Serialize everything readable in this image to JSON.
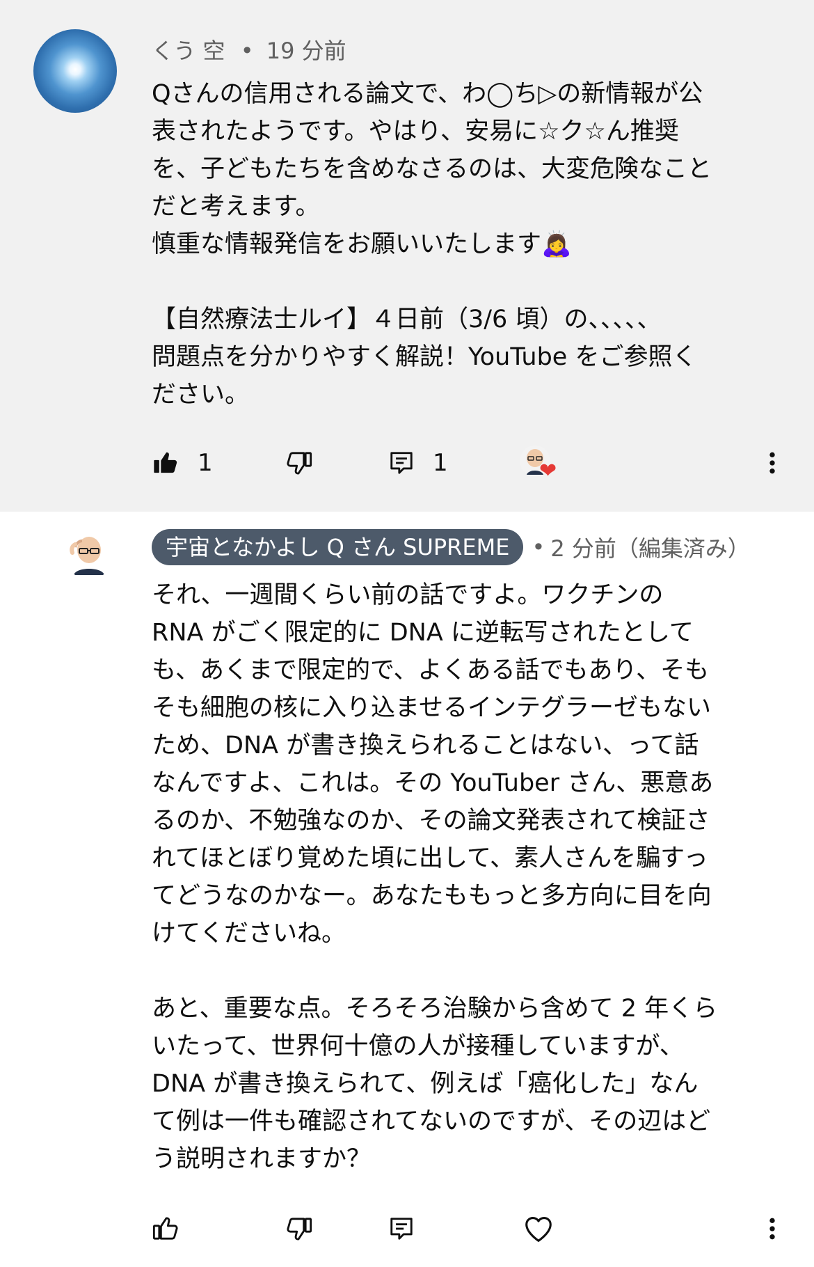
{
  "comments": [
    {
      "author": "くう 空",
      "separator": "•",
      "time": "19 分前",
      "text": "Qさんの信用される論文で、わ◯ち▷の新情報が公\n表されたようです。やはり、安易に☆ク☆ん推奨\nを、子どもたちを含めなさるのは、大変危険なこと\nだと考えます。\n慎重な情報発信をお願いいたします🙇‍♀️\n\n【自然療法士ルイ】４日前（3/6 頃）の、、、、、\n問題点を分かりやすく解説！YouTube をご参照く\nださい。",
      "like_count": "1",
      "reply_count": "1",
      "heart": "❤"
    },
    {
      "author": "宇宙となかよし Q さん SUPREME",
      "separator": "•",
      "time": "2 分前（編集済み）",
      "text": "それ、一週間くらい前の話ですよ。ワクチンの\nRNA がごく限定的に DNA に逆転写されたとして\nも、あくまで限定的で、よくある話でもあり、そも\nそも細胞の核に入り込ませるインテグラーゼもない\nため、DNA が書き換えられることはない、って話\nなんですよ、これは。その YouTuber さん、悪意あ\nるのか、不勉強なのか、その論文発表されて検証さ\nれてほとぼり覚めた頃に出して、素人さんを騙すっ\nてどうなのかなー。あなたももっと多方向に目を向\nけてくださいね。\n\nあと、重要な点。そろそろ治験から含めて 2 年くら\nいたって、世界何十億の人が接種していますが、\nDNA が書き換えられて、例えば「癌化した」なん\nて例は一件も確認されてないのですが、その辺はど\nう説明されますか？"
    }
  ],
  "colors": {
    "thread_bg": "#f1f1f1",
    "badge_bg": "#4d5a6a",
    "heart": "#e53935"
  }
}
